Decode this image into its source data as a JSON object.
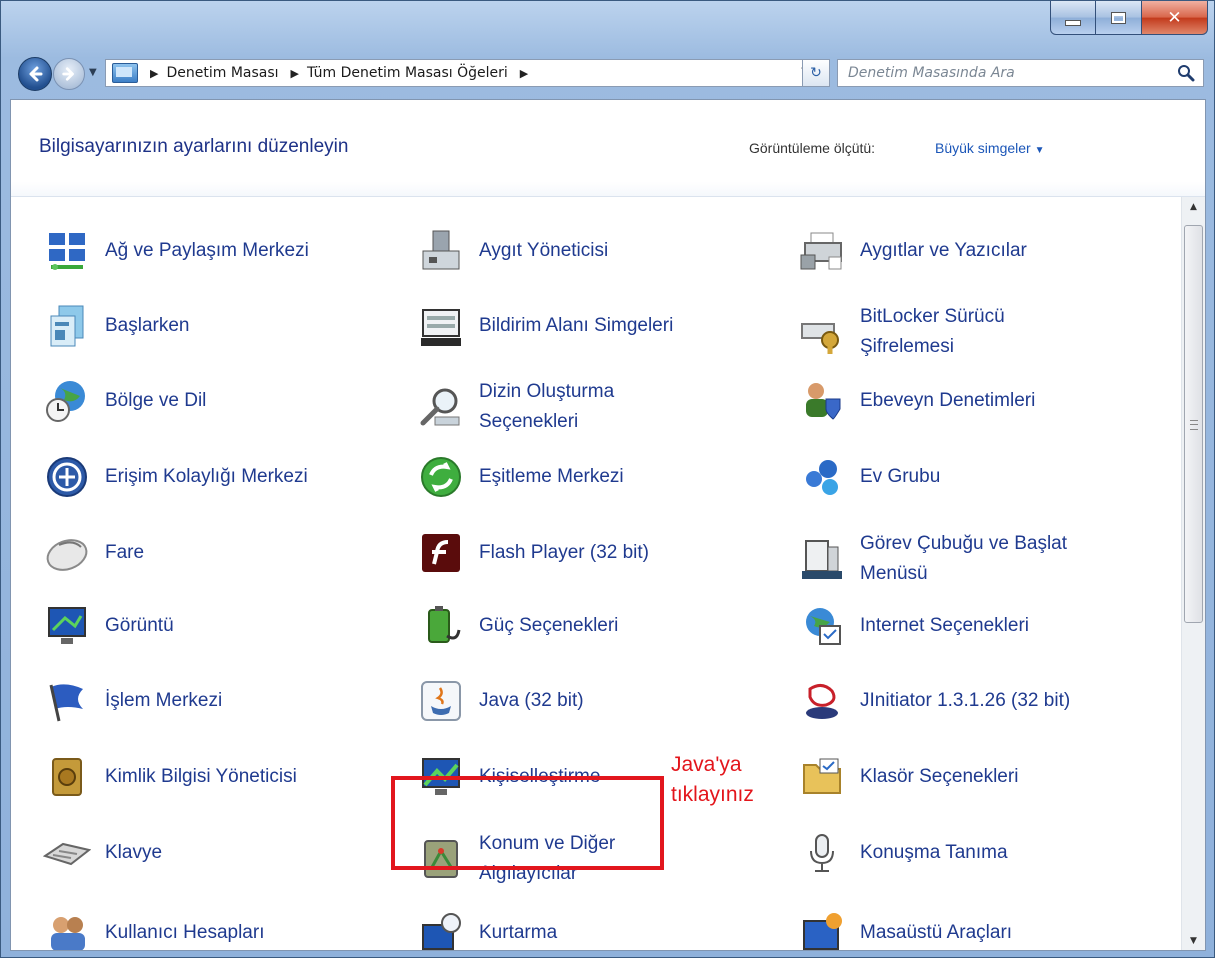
{
  "address": {
    "crumbs": [
      "Denetim Masası",
      "Tüm Denetim Masası Öğeleri"
    ]
  },
  "search": {
    "placeholder": "Denetim Masasında Ara"
  },
  "header": {
    "title": "Bilgisayarınızın ayarlarını düzenleyin",
    "view_label": "Görüntüleme ölçütü:",
    "view_value": "Büyük simgeler"
  },
  "items": [
    {
      "label": "Ağ ve Paylaşım Merkezi",
      "icon": "network-icon"
    },
    {
      "label": "Aygıt Yöneticisi",
      "icon": "device-manager-icon"
    },
    {
      "label": "Aygıtlar ve Yazıcılar",
      "icon": "printer-icon"
    },
    {
      "label": "Başlarken",
      "icon": "getting-started-icon"
    },
    {
      "label": "Bildirim Alanı Simgeleri",
      "icon": "notification-area-icon"
    },
    {
      "label": "BitLocker Sürücü Şifrelemesi",
      "icon": "bitlocker-key-icon"
    },
    {
      "label": "Bölge ve Dil",
      "icon": "globe-clock-icon"
    },
    {
      "label": "Dizin Oluşturma Seçenekleri",
      "icon": "indexing-magnifier-icon"
    },
    {
      "label": "Ebeveyn Denetimleri",
      "icon": "parental-controls-icon"
    },
    {
      "label": "Erişim Kolaylığı Merkezi",
      "icon": "accessibility-icon"
    },
    {
      "label": "Eşitleme Merkezi",
      "icon": "sync-icon"
    },
    {
      "label": "Ev Grubu",
      "icon": "homegroup-icon"
    },
    {
      "label": "Fare",
      "icon": "mouse-icon"
    },
    {
      "label": "Flash Player (32 bit)",
      "icon": "flash-icon"
    },
    {
      "label": "Görev Çubuğu ve Başlat Menüsü",
      "icon": "taskbar-icon"
    },
    {
      "label": "Görüntü",
      "icon": "display-icon"
    },
    {
      "label": "Güç Seçenekleri",
      "icon": "power-battery-icon"
    },
    {
      "label": "Internet Seçenekleri",
      "icon": "internet-options-icon"
    },
    {
      "label": "İşlem Merkezi",
      "icon": "action-center-flag-icon"
    },
    {
      "label": "Java (32 bit)",
      "icon": "java-cup-icon"
    },
    {
      "label": "JInitiator 1.3.1.26 (32 bit)",
      "icon": "jinitiator-icon"
    },
    {
      "label": "Kimlik Bilgisi Yöneticisi",
      "icon": "credential-vault-icon"
    },
    {
      "label": "Kişiselleştirme",
      "icon": "personalization-icon"
    },
    {
      "label": "Klasör Seçenekleri",
      "icon": "folder-options-icon"
    },
    {
      "label": "Klavye",
      "icon": "keyboard-icon"
    },
    {
      "label": "Konum ve Diğer Algılayıcılar",
      "icon": "location-sensor-icon"
    },
    {
      "label": "Konuşma Tanıma",
      "icon": "microphone-icon"
    },
    {
      "label": "Kullanıcı Hesapları",
      "icon": "user-accounts-icon"
    },
    {
      "label": "Kurtarma",
      "icon": "recovery-icon"
    },
    {
      "label": "Masaüstü Araçları",
      "icon": "desktop-gadgets-icon"
    }
  ],
  "annotation": {
    "line1": "Java'ya",
    "line2": "tıklayınız",
    "color": "#e3151b"
  }
}
